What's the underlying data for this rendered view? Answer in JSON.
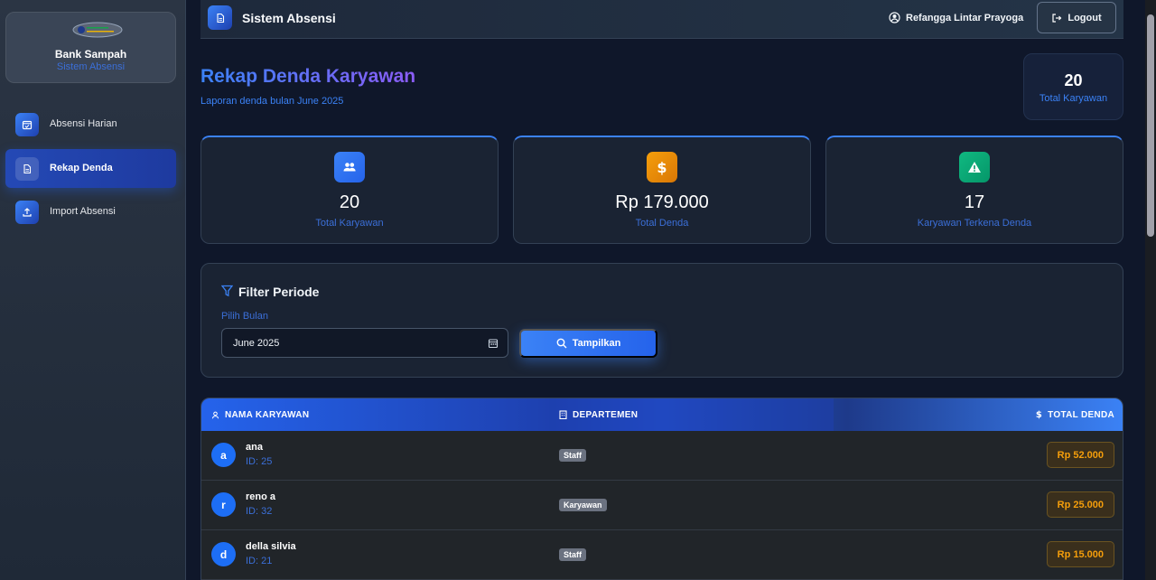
{
  "sidebar": {
    "brand_title": "Bank Sampah",
    "brand_subtitle": "Sistem Absensi",
    "items": [
      {
        "label": "Absensi Harian",
        "icon": "calendar-check-icon",
        "active": false
      },
      {
        "label": "Rekap Denda",
        "icon": "document-icon",
        "active": true
      },
      {
        "label": "Import Absensi",
        "icon": "upload-icon",
        "active": false
      }
    ]
  },
  "header": {
    "app_title": "Sistem Absensi",
    "user_name": "Refangga Lintar Prayoga",
    "logout_label": "Logout"
  },
  "page": {
    "title": "Rekap Denda Karyawan",
    "subtitle": "Laporan denda bulan June 2025",
    "summary_value": "20",
    "summary_label": "Total Karyawan"
  },
  "stats": [
    {
      "value": "20",
      "label": "Total Karyawan",
      "icon": "users-icon",
      "color": "#3b82f6"
    },
    {
      "value": "Rp 179.000",
      "label": "Total Denda",
      "icon": "dollar-icon",
      "color": "#f59e0b"
    },
    {
      "value": "17",
      "label": "Karyawan Terkena Denda",
      "icon": "warning-icon",
      "color": "#10b981"
    }
  ],
  "filter": {
    "title": "Filter Periode",
    "month_label": "Pilih Bulan",
    "month_value": "June 2025",
    "button_label": "Tampilkan"
  },
  "table": {
    "headers": [
      "NAMA KARYAWAN",
      "DEPARTEMEN",
      "TOTAL DENDA"
    ],
    "rows": [
      {
        "initial": "a",
        "name": "ana",
        "id": "ID: 25",
        "department": "Staff",
        "fine": "Rp 52.000"
      },
      {
        "initial": "r",
        "name": "reno a",
        "id": "ID: 32",
        "department": "Karyawan",
        "fine": "Rp 25.000"
      },
      {
        "initial": "d",
        "name": "della silvia",
        "id": "ID: 21",
        "department": "Staff",
        "fine": "Rp 15.000"
      }
    ]
  },
  "colors": {
    "accent": "#3b82f6",
    "fine": "#f59e0b",
    "background": "#0f172a"
  }
}
